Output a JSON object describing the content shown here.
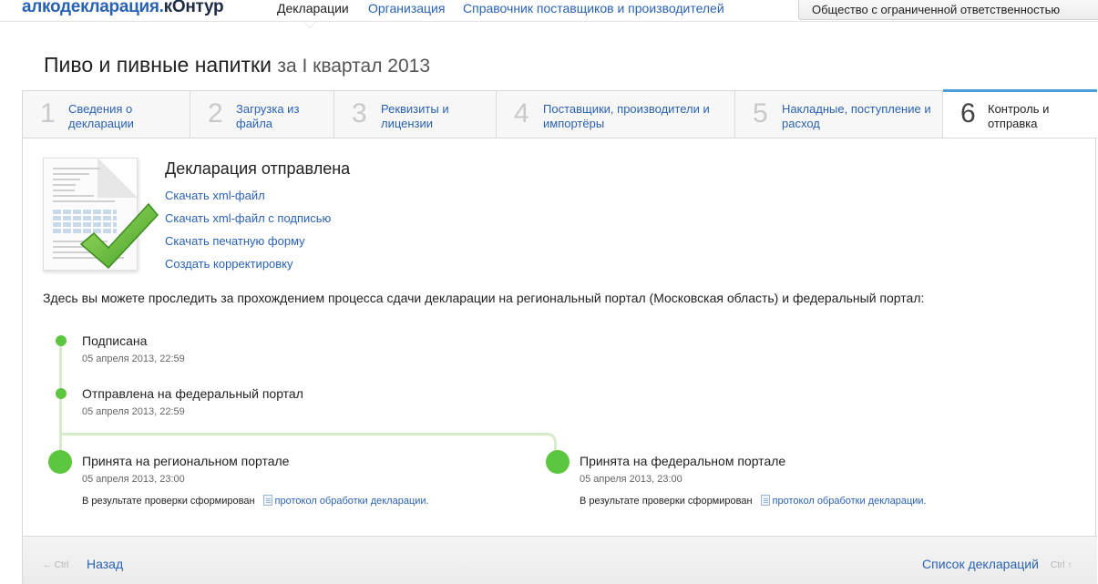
{
  "header": {
    "logo_main": "алкодекларация.",
    "logo_brand": "кОнтур",
    "nav": [
      {
        "label": "Декларации",
        "active": true
      },
      {
        "label": "Организация",
        "active": false
      },
      {
        "label": "Справочник поставщиков и производителей",
        "active": false
      }
    ],
    "organization": "Общество с ограниченной ответственностью"
  },
  "page": {
    "title": "Пиво и пивные напитки",
    "period": "за I квартал 2013"
  },
  "steps": [
    {
      "num": "1",
      "label_line1": "Сведения о",
      "label_line2": "декларации",
      "active": false
    },
    {
      "num": "2",
      "label_line1": "Загрузка из",
      "label_line2": "файла",
      "active": false
    },
    {
      "num": "3",
      "label_line1": "Реквизиты и",
      "label_line2": "лицензии",
      "active": false
    },
    {
      "num": "4",
      "label_line1": "Поставщики, производители и",
      "label_line2": "импортёры",
      "active": false
    },
    {
      "num": "5",
      "label_line1": "Накладные, поступление и",
      "label_line2": "расход",
      "active": false
    },
    {
      "num": "6",
      "label_line1": "Контроль и",
      "label_line2": "отправка",
      "active": true
    }
  ],
  "declaration": {
    "status_title": "Декларация отправлена",
    "links": [
      "Скачать xml-файл",
      "Скачать xml-файл с подписью",
      "Скачать печатную форму",
      "Создать корректировку"
    ]
  },
  "tracking_text": "Здесь вы можете проследить за прохождением процесса сдачи декларации на региональный портал (Московская область) и федеральный портал:",
  "timeline": {
    "signed": {
      "title": "Подписана",
      "date": "05 апреля 2013, 22:59"
    },
    "sent": {
      "title": "Отправлена на федеральный портал",
      "date": "05 апреля 2013, 22:59"
    },
    "regional": {
      "title": "Принята на региональном портале",
      "date": "05 апреля 2013, 23:00",
      "note": "В результате проверки сформирован",
      "link": "протокол обработки декларации."
    },
    "federal": {
      "title": "Принята на федеральном портале",
      "date": "05 апреля 2013, 23:00",
      "note": "В результате проверки сформирован",
      "link": "протокол обработки декларации."
    }
  },
  "footer": {
    "back_hint": "← Ctrl",
    "back_label": "Назад",
    "list_label": "Список деклараций",
    "list_hint": "Ctrl ↑"
  },
  "colors": {
    "link": "#2a62b2",
    "accent": "#4aa0dc",
    "success": "#5cc63e"
  }
}
